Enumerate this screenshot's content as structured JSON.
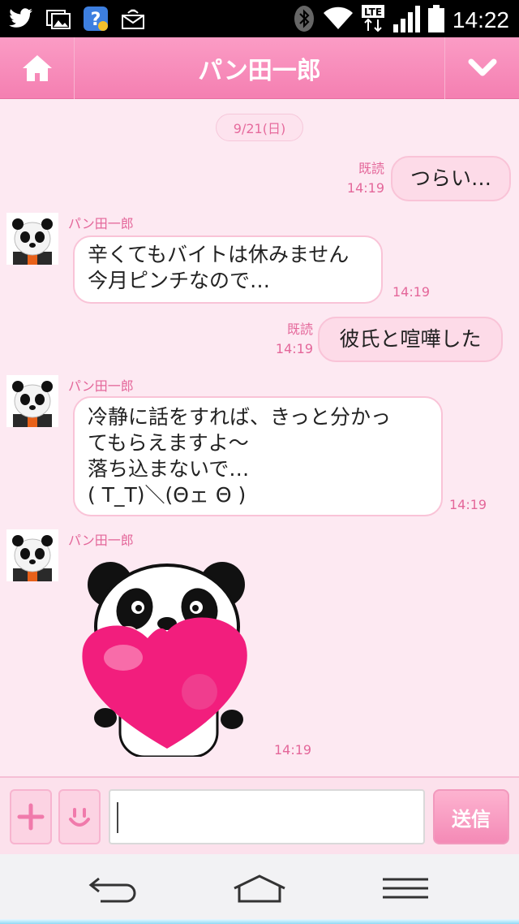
{
  "status_bar": {
    "icons_left": [
      "twitter-icon",
      "photo-icon",
      "help-badge-icon",
      "mail-icon"
    ],
    "network": "LTE",
    "time": "14:22"
  },
  "header": {
    "title": "パン田一郎"
  },
  "chat": {
    "date": "9/21(日)",
    "messages": [
      {
        "side": "out",
        "text": "つらい…",
        "read_label": "既読",
        "time": "14:19"
      },
      {
        "side": "in",
        "sender": "パン田一郎",
        "lines": [
          "辛くてもバイトは休みません",
          "今月ピンチなので…"
        ],
        "time": "14:19"
      },
      {
        "side": "out",
        "text": "彼氏と喧嘩した",
        "read_label": "既読",
        "time": "14:19"
      },
      {
        "side": "in",
        "sender": "パン田一郎",
        "lines": [
          "冷静に話をすれば、きっと分かっ",
          "てもらえますよ〜",
          "落ち込まないで…",
          "( T_T)＼(Θェ Θ )"
        ],
        "time": "14:19"
      },
      {
        "side": "in",
        "sender": "パン田一郎",
        "sticker": "panda-heart-sticker",
        "time": "14:19"
      }
    ]
  },
  "input_bar": {
    "text_value": "",
    "send_label": "送信"
  },
  "colors": {
    "header": "#f47fb1",
    "bubble_out": "#fddbe8",
    "accent_text": "#e4679a"
  }
}
